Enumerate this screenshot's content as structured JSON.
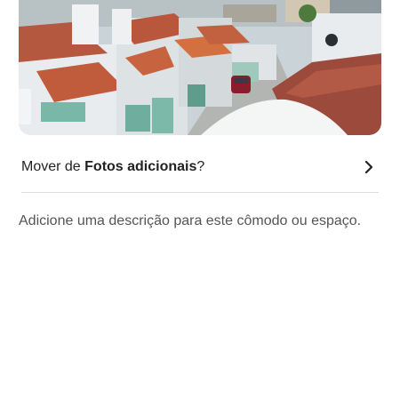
{
  "photo": {
    "alt_icon": "house-photo"
  },
  "move_row": {
    "prefix": "Mover de ",
    "album": "Fotos adicionais",
    "suffix": "?",
    "chevron_icon": "chevron-right-icon"
  },
  "description": {
    "prompt": "Adicione uma descrição para este cômodo ou espaço."
  },
  "colors": {
    "text": "#222222",
    "muted": "#555555",
    "divider": "#dddddd"
  }
}
